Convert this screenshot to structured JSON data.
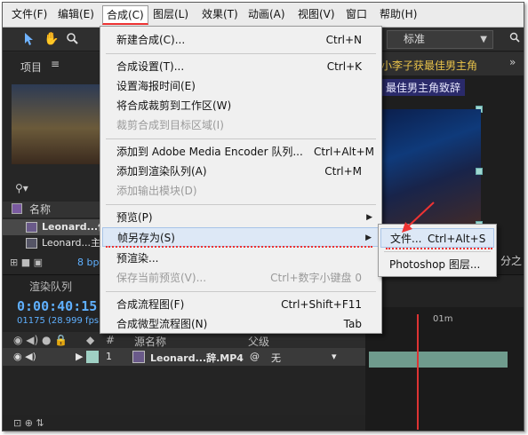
{
  "menubar": {
    "items": [
      "文件(F)",
      "编辑(E)",
      "合成(C)",
      "图层(L)",
      "效果(T)",
      "动画(A)",
      "视图(V)",
      "窗口",
      "帮助(H)"
    ]
  },
  "toolbar": {
    "workspace_label": "标准"
  },
  "panels": {
    "project_tab": "项目",
    "project_col_name": "名称",
    "project_items": [
      "Leonard...佳",
      "Leonard...主角"
    ],
    "bpc": "8 bpc",
    "comp_title": "小李子获最佳男主角",
    "comp_subtitle": "最佳男主角致辞",
    "side_label": "分之",
    "accent_color": "#e33333"
  },
  "timeline": {
    "render_queue_tab": "渲染队列",
    "timecode": "0:00:40:15",
    "frame_info": "01175 (28.999 fps)",
    "header_col_num": "#",
    "header_col_source": "源名称",
    "header_col_parent": "父级",
    "layer_number": "1",
    "layer_name": "Leonard...辞.MP4",
    "layer_parent": "无",
    "ruler_label": "01m"
  },
  "menu": {
    "items": [
      {
        "label": "新建合成(C)...",
        "shortcut": "Ctrl+N"
      },
      {
        "label": "合成设置(T)...",
        "shortcut": "Ctrl+K"
      },
      {
        "label": "设置海报时间(E)",
        "shortcut": ""
      },
      {
        "label": "将合成裁剪到工作区(W)",
        "shortcut": ""
      },
      {
        "label": "裁剪合成到目标区域(I)",
        "shortcut": ""
      },
      {
        "label": "添加到 Adobe Media Encoder 队列...",
        "shortcut": "Ctrl+Alt+M"
      },
      {
        "label": "添加到渲染队列(A)",
        "shortcut": "Ctrl+M"
      },
      {
        "label": "添加输出模块(D)",
        "shortcut": ""
      },
      {
        "label": "预览(P)",
        "shortcut": ""
      },
      {
        "label": "帧另存为(S)",
        "shortcut": ""
      },
      {
        "label": "预渲染...",
        "shortcut": ""
      },
      {
        "label": "保存当前预览(V)...",
        "shortcut": "Ctrl+数字小键盘 0"
      },
      {
        "label": "合成流程图(F)",
        "shortcut": "Ctrl+Shift+F11"
      },
      {
        "label": "合成微型流程图(N)",
        "shortcut": "Tab"
      }
    ]
  },
  "submenu": {
    "items": [
      {
        "label": "文件...",
        "shortcut": "Ctrl+Alt+S"
      },
      {
        "label": "Photoshop 图层...",
        "shortcut": ""
      }
    ]
  }
}
